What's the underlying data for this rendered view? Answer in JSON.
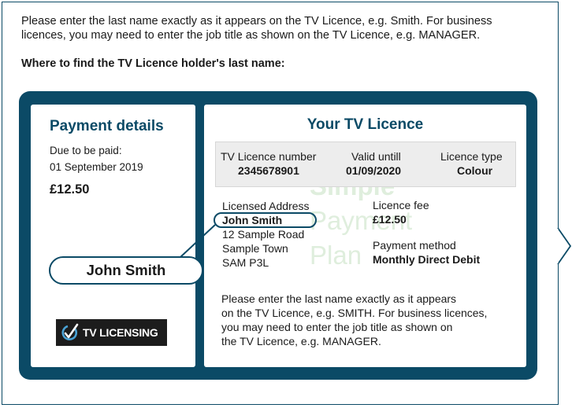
{
  "intro": {
    "line1": "Please enter the last name exactly as it appears on the TV Licence, e.g. Smith. For business",
    "line2": "licences, you may need to enter the job title as shown on the TV Licence, e.g. MANAGER.",
    "heading": "Where to find the TV Licence holder's last name:"
  },
  "payment": {
    "title": "Payment details",
    "due_label": "Due to be paid:",
    "due_date": "01 September 2019",
    "amount": "£12.50"
  },
  "logo": {
    "text": "TV LICENSING"
  },
  "licence": {
    "title": "Your TV Licence",
    "number_label": "TV Licence number",
    "number_value": "2345678901",
    "valid_label": "Valid untill",
    "valid_value": "01/09/2020",
    "type_label": "Licence type",
    "type_value": "Colour",
    "address_label": "Licensed Address",
    "address_name": "John Smith",
    "address_lines": [
      "12 Sample Road",
      "Sample Town",
      "SAM P3L"
    ],
    "fee_label": "Licence fee",
    "fee_value": "£12.50",
    "method_label": "Payment method",
    "method_value": "Monthly Direct Debit",
    "note": [
      "Please enter the last name exactly as it appears",
      "on the TV Licence, e.g. SMITH. For business licences,",
      "you may need to enter the job title as shown on",
      "the TV Licence, e.g. MANAGER."
    ],
    "watermark": [
      "Simple",
      "Payment",
      "Plan"
    ]
  },
  "callout": {
    "name": "John Smith"
  },
  "colors": {
    "navy": "#0b4a66",
    "watermark_green": "#dfeedd",
    "logo_bg": "#1c1c1c"
  }
}
